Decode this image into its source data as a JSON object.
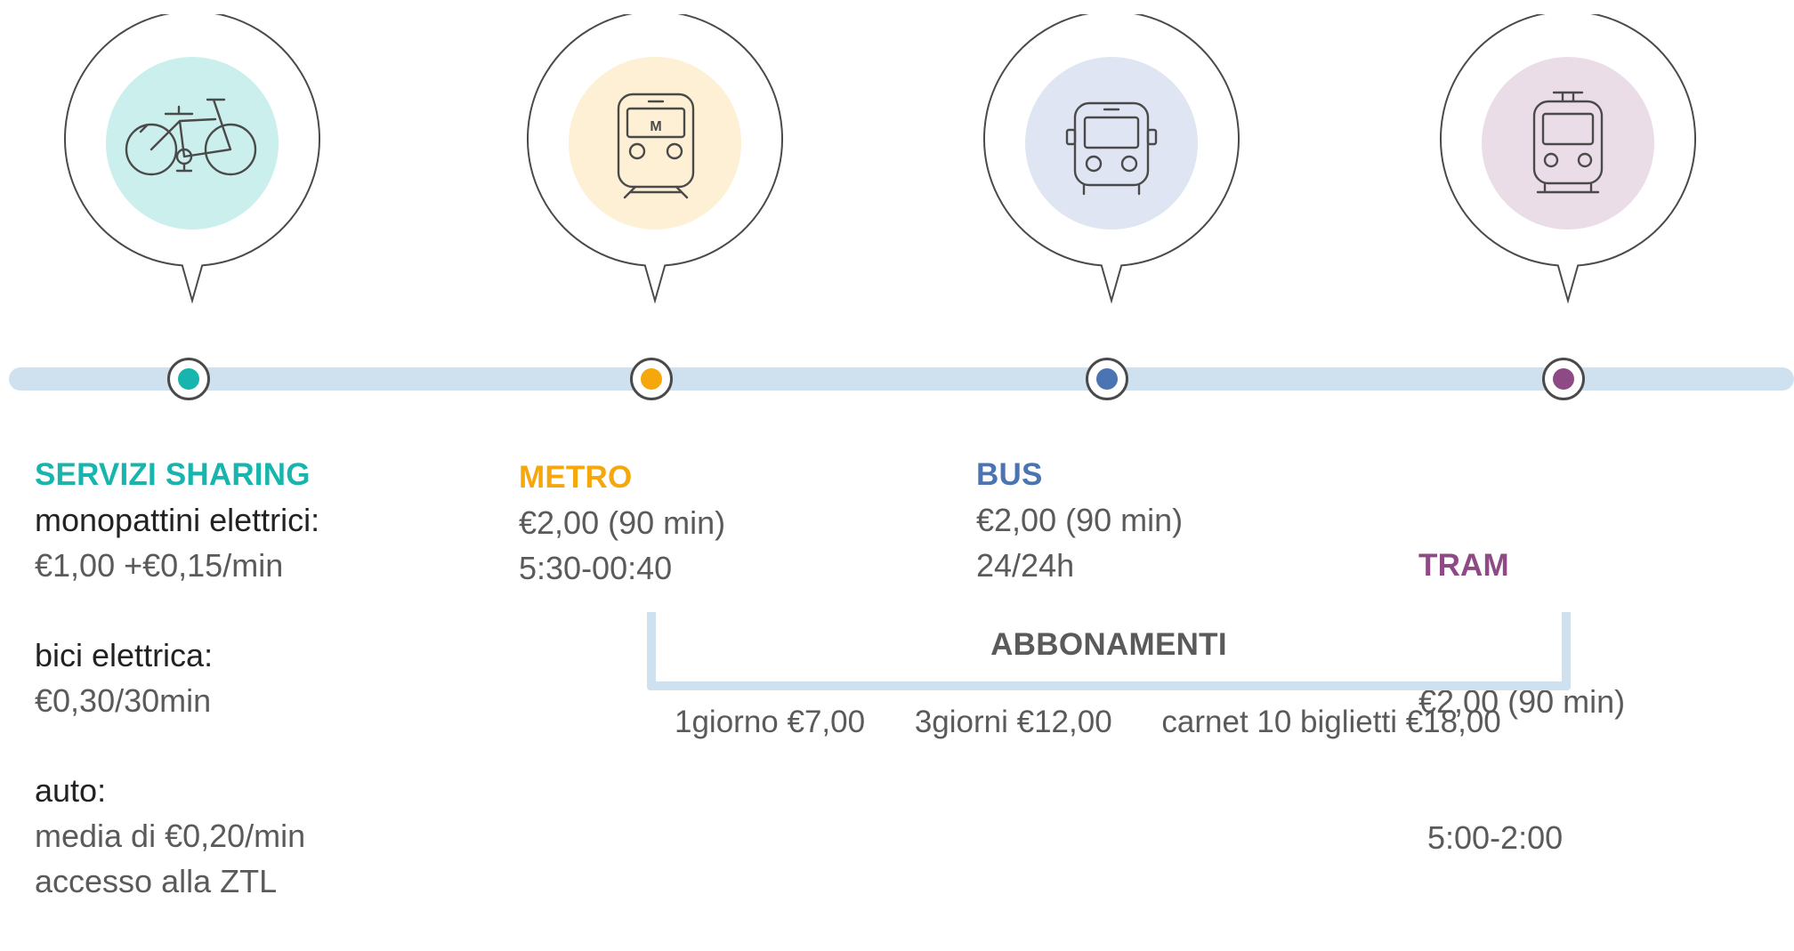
{
  "modes": [
    {
      "id": "sharing",
      "heading": "SERVIZI SHARING",
      "color": "#17b5ad",
      "tint": "#cbefec",
      "icon": "bicycle-icon"
    },
    {
      "id": "metro",
      "heading": "METRO",
      "color": "#f5a70b",
      "tint": "#fdf0d4",
      "icon": "metro-train-icon",
      "icon_letter": "M",
      "price": "€2,00 (90 min)",
      "hours": "5:30-00:40"
    },
    {
      "id": "bus",
      "heading": "BUS",
      "color": "#4a74b2",
      "tint": "#dfe5f2",
      "icon": "bus-icon",
      "price": "€2,00 (90 min)",
      "hours": "24/24h"
    },
    {
      "id": "tram",
      "heading": "TRAM",
      "color": "#8e4a84",
      "tint": "#ebdde8",
      "icon": "tram-icon",
      "price": "€2,00 (90 min)",
      "hours": " 5:00-2:00"
    }
  ],
  "sharing": {
    "scooters_label": "monopattini elettrici:",
    "scooters_price": "€1,00 +€0,15/min",
    "ebike_label": "bici elettrica:",
    "ebike_price": "€0,30/30min",
    "car_label": "auto:",
    "car_price": "media di €0,20/min",
    "car_note": "accesso alla ZTL"
  },
  "timeline_color": "#cfe1ef",
  "abbonamenti": {
    "title": "ABBONAMENTI",
    "items": [
      "1giorno €7,00",
      "3giorni €12,00",
      "carnet 10 biglietti €18,00"
    ]
  }
}
